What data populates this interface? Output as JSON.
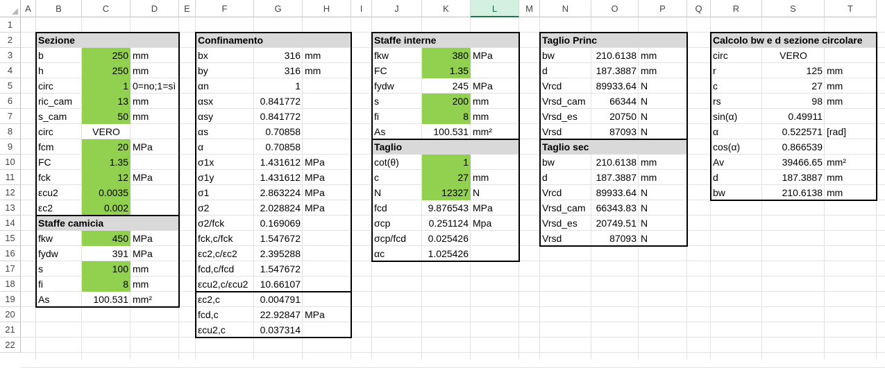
{
  "columns": [
    "A",
    "B",
    "C",
    "D",
    "E",
    "F",
    "G",
    "H",
    "I",
    "J",
    "K",
    "L",
    "M",
    "N",
    "O",
    "P",
    "Q",
    "R",
    "S",
    "T"
  ],
  "rows": [
    "1",
    "2",
    "3",
    "4",
    "5",
    "6",
    "7",
    "8",
    "9",
    "10",
    "11",
    "12",
    "13",
    "14",
    "15",
    "16",
    "17",
    "18",
    "19",
    "20",
    "21",
    "22"
  ],
  "selected_column": "L",
  "colors": {
    "input_fill": "#92d050",
    "header_fill": "#d9d9d9",
    "selected_header": "#d3f0e0"
  },
  "tables": [
    {
      "id": "sezione",
      "cells": [
        {
          "col": "B",
          "row": 2,
          "v": "Sezione",
          "bold": true
        },
        {
          "col": "B",
          "row": 3,
          "v": "b"
        },
        {
          "col": "C",
          "row": 3,
          "v": "250",
          "align": "r"
        },
        {
          "col": "D",
          "row": 3,
          "v": "mm"
        },
        {
          "col": "B",
          "row": 4,
          "v": "h"
        },
        {
          "col": "C",
          "row": 4,
          "v": "250",
          "align": "r"
        },
        {
          "col": "D",
          "row": 4,
          "v": "mm"
        },
        {
          "col": "B",
          "row": 5,
          "v": "circ"
        },
        {
          "col": "C",
          "row": 5,
          "v": "1",
          "align": "r"
        },
        {
          "col": "D",
          "row": 5,
          "v": "0=no;1=sì"
        },
        {
          "col": "B",
          "row": 6,
          "v": "ric_cam"
        },
        {
          "col": "C",
          "row": 6,
          "v": "13",
          "align": "r"
        },
        {
          "col": "D",
          "row": 6,
          "v": "mm"
        },
        {
          "col": "B",
          "row": 7,
          "v": "s_cam"
        },
        {
          "col": "C",
          "row": 7,
          "v": "50",
          "align": "r"
        },
        {
          "col": "D",
          "row": 7,
          "v": "mm"
        },
        {
          "col": "B",
          "row": 8,
          "v": "circ"
        },
        {
          "col": "C",
          "row": 8,
          "v": "VERO",
          "align": "c"
        },
        {
          "col": "B",
          "row": 9,
          "v": "fcm"
        },
        {
          "col": "C",
          "row": 9,
          "v": "20",
          "align": "r"
        },
        {
          "col": "D",
          "row": 9,
          "v": "MPa"
        },
        {
          "col": "B",
          "row": 10,
          "v": "FC"
        },
        {
          "col": "C",
          "row": 10,
          "v": "1.35",
          "align": "r"
        },
        {
          "col": "B",
          "row": 11,
          "v": "fck"
        },
        {
          "col": "C",
          "row": 11,
          "v": "12",
          "align": "r"
        },
        {
          "col": "D",
          "row": 11,
          "v": "MPa"
        },
        {
          "col": "B",
          "row": 12,
          "v": "εcu2"
        },
        {
          "col": "C",
          "row": 12,
          "v": "0.0035",
          "align": "r"
        },
        {
          "col": "B",
          "row": 13,
          "v": "εc2"
        },
        {
          "col": "C",
          "row": 13,
          "v": "0.002",
          "align": "r"
        },
        {
          "col": "B",
          "row": 14,
          "v": "Staffe camicia",
          "bold": true
        },
        {
          "col": "B",
          "row": 15,
          "v": "fkw"
        },
        {
          "col": "C",
          "row": 15,
          "v": "450",
          "align": "r"
        },
        {
          "col": "D",
          "row": 15,
          "v": "MPa"
        },
        {
          "col": "B",
          "row": 16,
          "v": "fydw"
        },
        {
          "col": "C",
          "row": 16,
          "v": "391",
          "align": "r"
        },
        {
          "col": "D",
          "row": 16,
          "v": "MPa"
        },
        {
          "col": "B",
          "row": 17,
          "v": "s"
        },
        {
          "col": "C",
          "row": 17,
          "v": "100",
          "align": "r"
        },
        {
          "col": "D",
          "row": 17,
          "v": "mm"
        },
        {
          "col": "B",
          "row": 18,
          "v": "fi"
        },
        {
          "col": "C",
          "row": 18,
          "v": "8",
          "align": "r"
        },
        {
          "col": "D",
          "row": 18,
          "v": "mm"
        },
        {
          "col": "B",
          "row": 19,
          "v": "As"
        },
        {
          "col": "C",
          "row": 19,
          "v": "100.531",
          "align": "r"
        },
        {
          "col": "D",
          "row": 19,
          "v": "mm²"
        }
      ]
    },
    {
      "id": "confinamento",
      "cells": [
        {
          "col": "F",
          "row": 2,
          "v": "Confinamento",
          "bold": true
        },
        {
          "col": "F",
          "row": 3,
          "v": "bx"
        },
        {
          "col": "G",
          "row": 3,
          "v": "316",
          "align": "r"
        },
        {
          "col": "H",
          "row": 3,
          "v": "mm"
        },
        {
          "col": "F",
          "row": 4,
          "v": "by"
        },
        {
          "col": "G",
          "row": 4,
          "v": "316",
          "align": "r"
        },
        {
          "col": "H",
          "row": 4,
          "v": "mm"
        },
        {
          "col": "F",
          "row": 5,
          "v": "αn"
        },
        {
          "col": "G",
          "row": 5,
          "v": "1",
          "align": "r"
        },
        {
          "col": "F",
          "row": 6,
          "v": "αsx"
        },
        {
          "col": "G",
          "row": 6,
          "v": "0.841772",
          "align": "r"
        },
        {
          "col": "F",
          "row": 7,
          "v": "αsy"
        },
        {
          "col": "G",
          "row": 7,
          "v": "0.841772",
          "align": "r"
        },
        {
          "col": "F",
          "row": 8,
          "v": "αs"
        },
        {
          "col": "G",
          "row": 8,
          "v": "0.70858",
          "align": "r"
        },
        {
          "col": "F",
          "row": 9,
          "v": "α"
        },
        {
          "col": "G",
          "row": 9,
          "v": "0.70858",
          "align": "r"
        },
        {
          "col": "F",
          "row": 10,
          "v": "σ1x"
        },
        {
          "col": "G",
          "row": 10,
          "v": "1.431612",
          "align": "r"
        },
        {
          "col": "H",
          "row": 10,
          "v": "MPa"
        },
        {
          "col": "F",
          "row": 11,
          "v": "σ1y"
        },
        {
          "col": "G",
          "row": 11,
          "v": "1.431612",
          "align": "r"
        },
        {
          "col": "H",
          "row": 11,
          "v": "MPa"
        },
        {
          "col": "F",
          "row": 12,
          "v": "σ1"
        },
        {
          "col": "G",
          "row": 12,
          "v": "2.863224",
          "align": "r"
        },
        {
          "col": "H",
          "row": 12,
          "v": "MPa"
        },
        {
          "col": "F",
          "row": 13,
          "v": "σ2"
        },
        {
          "col": "G",
          "row": 13,
          "v": "2.028824",
          "align": "r"
        },
        {
          "col": "H",
          "row": 13,
          "v": "MPa"
        },
        {
          "col": "F",
          "row": 14,
          "v": "σ2/fck"
        },
        {
          "col": "G",
          "row": 14,
          "v": "0.169069",
          "align": "r"
        },
        {
          "col": "F",
          "row": 15,
          "v": "fck,c/fck"
        },
        {
          "col": "G",
          "row": 15,
          "v": "1.547672",
          "align": "r"
        },
        {
          "col": "F",
          "row": 16,
          "v": "εc2,c/εc2"
        },
        {
          "col": "G",
          "row": 16,
          "v": "2.395288",
          "align": "r"
        },
        {
          "col": "F",
          "row": 17,
          "v": "fcd,c/fcd"
        },
        {
          "col": "G",
          "row": 17,
          "v": "1.547672",
          "align": "r"
        },
        {
          "col": "F",
          "row": 18,
          "v": "εcu2,c/εcu2"
        },
        {
          "col": "G",
          "row": 18,
          "v": "10.66107",
          "align": "r"
        },
        {
          "col": "F",
          "row": 19,
          "v": "εc2,c"
        },
        {
          "col": "G",
          "row": 19,
          "v": "0.004791",
          "align": "r"
        },
        {
          "col": "F",
          "row": 20,
          "v": "fcd,c"
        },
        {
          "col": "G",
          "row": 20,
          "v": "22.92847",
          "align": "r"
        },
        {
          "col": "H",
          "row": 20,
          "v": "MPa"
        },
        {
          "col": "F",
          "row": 21,
          "v": "εcu2,c"
        },
        {
          "col": "G",
          "row": 21,
          "v": "0.037314",
          "align": "r"
        }
      ]
    },
    {
      "id": "staffe-interne",
      "cells": [
        {
          "col": "J",
          "row": 2,
          "v": "Staffe interne",
          "bold": true
        },
        {
          "col": "J",
          "row": 3,
          "v": "fkw"
        },
        {
          "col": "K",
          "row": 3,
          "v": "380",
          "align": "r"
        },
        {
          "col": "L",
          "row": 3,
          "v": "MPa"
        },
        {
          "col": "J",
          "row": 4,
          "v": "FC"
        },
        {
          "col": "K",
          "row": 4,
          "v": "1.35",
          "align": "r"
        },
        {
          "col": "J",
          "row": 5,
          "v": "fydw"
        },
        {
          "col": "K",
          "row": 5,
          "v": "245",
          "align": "r"
        },
        {
          "col": "L",
          "row": 5,
          "v": "MPa"
        },
        {
          "col": "J",
          "row": 6,
          "v": "s"
        },
        {
          "col": "K",
          "row": 6,
          "v": "200",
          "align": "r"
        },
        {
          "col": "L",
          "row": 6,
          "v": "mm"
        },
        {
          "col": "J",
          "row": 7,
          "v": "fi"
        },
        {
          "col": "K",
          "row": 7,
          "v": "8",
          "align": "r"
        },
        {
          "col": "L",
          "row": 7,
          "v": "mm"
        },
        {
          "col": "J",
          "row": 8,
          "v": "As"
        },
        {
          "col": "K",
          "row": 8,
          "v": "100.531",
          "align": "r"
        },
        {
          "col": "L",
          "row": 8,
          "v": "mm²"
        },
        {
          "col": "J",
          "row": 9,
          "v": "Taglio",
          "bold": true
        },
        {
          "col": "J",
          "row": 10,
          "v": "cot(θ)"
        },
        {
          "col": "K",
          "row": 10,
          "v": "1",
          "align": "r"
        },
        {
          "col": "J",
          "row": 11,
          "v": "c"
        },
        {
          "col": "K",
          "row": 11,
          "v": "27",
          "align": "r"
        },
        {
          "col": "L",
          "row": 11,
          "v": "mm"
        },
        {
          "col": "J",
          "row": 12,
          "v": "N"
        },
        {
          "col": "K",
          "row": 12,
          "v": "12327",
          "align": "r"
        },
        {
          "col": "L",
          "row": 12,
          "v": "N"
        },
        {
          "col": "J",
          "row": 13,
          "v": "fcd"
        },
        {
          "col": "K",
          "row": 13,
          "v": "9.876543",
          "align": "r"
        },
        {
          "col": "L",
          "row": 13,
          "v": "MPa"
        },
        {
          "col": "J",
          "row": 14,
          "v": "σcp"
        },
        {
          "col": "K",
          "row": 14,
          "v": "0.251124",
          "align": "r"
        },
        {
          "col": "L",
          "row": 14,
          "v": "Mpa"
        },
        {
          "col": "J",
          "row": 15,
          "v": "σcp/fcd"
        },
        {
          "col": "K",
          "row": 15,
          "v": "0.025426",
          "align": "r"
        },
        {
          "col": "J",
          "row": 16,
          "v": "αc"
        },
        {
          "col": "K",
          "row": 16,
          "v": "1.025426",
          "align": "r"
        }
      ]
    },
    {
      "id": "taglio",
      "cells": [
        {
          "col": "N",
          "row": 2,
          "v": "Taglio Princ",
          "bold": true
        },
        {
          "col": "N",
          "row": 3,
          "v": "bw"
        },
        {
          "col": "O",
          "row": 3,
          "v": "210.6138",
          "align": "r"
        },
        {
          "col": "P",
          "row": 3,
          "v": "mm"
        },
        {
          "col": "N",
          "row": 4,
          "v": "d"
        },
        {
          "col": "O",
          "row": 4,
          "v": "187.3887",
          "align": "r"
        },
        {
          "col": "P",
          "row": 4,
          "v": "mm"
        },
        {
          "col": "N",
          "row": 5,
          "v": "Vrcd"
        },
        {
          "col": "O",
          "row": 5,
          "v": "89933.64",
          "align": "r"
        },
        {
          "col": "P",
          "row": 5,
          "v": "N"
        },
        {
          "col": "N",
          "row": 6,
          "v": "Vrsd_cam"
        },
        {
          "col": "O",
          "row": 6,
          "v": "66344",
          "align": "r"
        },
        {
          "col": "P",
          "row": 6,
          "v": "N"
        },
        {
          "col": "N",
          "row": 7,
          "v": "Vrsd_es"
        },
        {
          "col": "O",
          "row": 7,
          "v": "20750",
          "align": "r"
        },
        {
          "col": "P",
          "row": 7,
          "v": "N"
        },
        {
          "col": "N",
          "row": 8,
          "v": "Vrsd"
        },
        {
          "col": "O",
          "row": 8,
          "v": "87093",
          "align": "r"
        },
        {
          "col": "P",
          "row": 8,
          "v": "N"
        },
        {
          "col": "N",
          "row": 9,
          "v": "Taglio sec",
          "bold": true
        },
        {
          "col": "N",
          "row": 10,
          "v": "bw"
        },
        {
          "col": "O",
          "row": 10,
          "v": "210.6138",
          "align": "r"
        },
        {
          "col": "P",
          "row": 10,
          "v": "mm"
        },
        {
          "col": "N",
          "row": 11,
          "v": "d"
        },
        {
          "col": "O",
          "row": 11,
          "v": "187.3887",
          "align": "r"
        },
        {
          "col": "P",
          "row": 11,
          "v": "mm"
        },
        {
          "col": "N",
          "row": 12,
          "v": "Vrcd"
        },
        {
          "col": "O",
          "row": 12,
          "v": "89933.64",
          "align": "r"
        },
        {
          "col": "P",
          "row": 12,
          "v": "N"
        },
        {
          "col": "N",
          "row": 13,
          "v": "Vrsd_cam"
        },
        {
          "col": "O",
          "row": 13,
          "v": "66343.83",
          "align": "r"
        },
        {
          "col": "P",
          "row": 13,
          "v": "N"
        },
        {
          "col": "N",
          "row": 14,
          "v": "Vrsd_es"
        },
        {
          "col": "O",
          "row": 14,
          "v": "20749.51",
          "align": "r"
        },
        {
          "col": "P",
          "row": 14,
          "v": "N"
        },
        {
          "col": "N",
          "row": 15,
          "v": "Vrsd"
        },
        {
          "col": "O",
          "row": 15,
          "v": "87093",
          "align": "r"
        },
        {
          "col": "P",
          "row": 15,
          "v": "N"
        }
      ]
    },
    {
      "id": "calcolo-bw",
      "cells": [
        {
          "col": "R",
          "row": 2,
          "v": "Calcolo bw e d sezione circolare",
          "bold": true
        },
        {
          "col": "R",
          "row": 3,
          "v": "circ"
        },
        {
          "col": "S",
          "row": 3,
          "v": "VERO",
          "align": "c"
        },
        {
          "col": "R",
          "row": 4,
          "v": "r"
        },
        {
          "col": "S",
          "row": 4,
          "v": "125",
          "align": "r"
        },
        {
          "col": "T",
          "row": 4,
          "v": "mm"
        },
        {
          "col": "R",
          "row": 5,
          "v": "c"
        },
        {
          "col": "S",
          "row": 5,
          "v": "27",
          "align": "r"
        },
        {
          "col": "T",
          "row": 5,
          "v": "mm"
        },
        {
          "col": "R",
          "row": 6,
          "v": "rs"
        },
        {
          "col": "S",
          "row": 6,
          "v": "98",
          "align": "r"
        },
        {
          "col": "T",
          "row": 6,
          "v": "mm"
        },
        {
          "col": "R",
          "row": 7,
          "v": "sin(α)"
        },
        {
          "col": "S",
          "row": 7,
          "v": "0.49911",
          "align": "r"
        },
        {
          "col": "R",
          "row": 8,
          "v": "α"
        },
        {
          "col": "S",
          "row": 8,
          "v": "0.522571",
          "align": "r"
        },
        {
          "col": "T",
          "row": 8,
          "v": "[rad]"
        },
        {
          "col": "R",
          "row": 9,
          "v": "cos(α)"
        },
        {
          "col": "S",
          "row": 9,
          "v": "0.866539",
          "align": "r"
        },
        {
          "col": "R",
          "row": 10,
          "v": "Av"
        },
        {
          "col": "S",
          "row": 10,
          "v": "39466.65",
          "align": "r"
        },
        {
          "col": "T",
          "row": 10,
          "v": "mm²"
        },
        {
          "col": "R",
          "row": 11,
          "v": "d"
        },
        {
          "col": "S",
          "row": 11,
          "v": "187.3887",
          "align": "r"
        },
        {
          "col": "T",
          "row": 11,
          "v": "mm"
        },
        {
          "col": "R",
          "row": 12,
          "v": "bw"
        },
        {
          "col": "S",
          "row": 12,
          "v": "210.6138",
          "align": "r"
        },
        {
          "col": "T",
          "row": 12,
          "v": "mm"
        }
      ]
    }
  ]
}
